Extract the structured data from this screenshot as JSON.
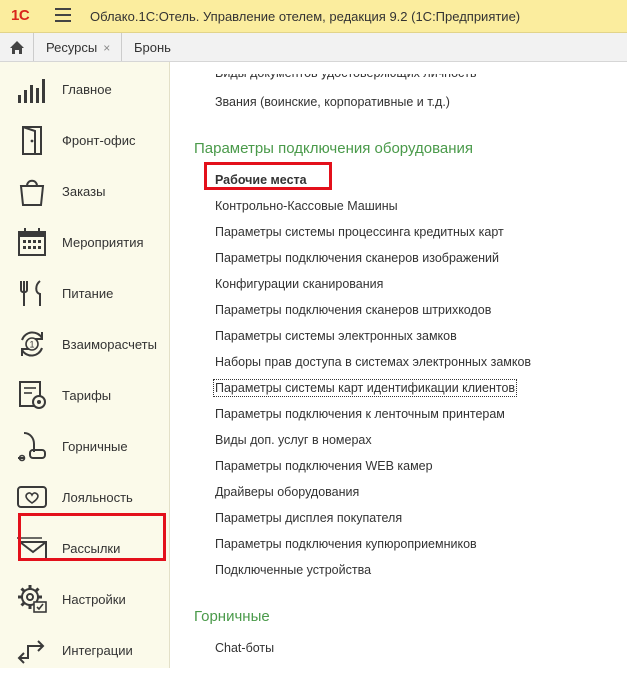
{
  "app": {
    "logo_text": "1С",
    "title": "Облако.1С:Отель. Управление отелем, редакция 9.2  (1С:Предприятие)"
  },
  "tabs": [
    {
      "label": "Ресурсы",
      "close": "×"
    },
    {
      "label": "Бронь",
      "close": ""
    }
  ],
  "sidebar": {
    "items": [
      {
        "label": "Главное",
        "icon": "bar-chart-icon"
      },
      {
        "label": "Фронт-офис",
        "icon": "door-icon"
      },
      {
        "label": "Заказы",
        "icon": "shopping-bag-icon"
      },
      {
        "label": "Мероприятия",
        "icon": "calendar-icon"
      },
      {
        "label": "Питание",
        "icon": "fork-knife-icon"
      },
      {
        "label": "Взаиморасчеты",
        "icon": "circular-arrows-icon"
      },
      {
        "label": "Тарифы",
        "icon": "tariff-tag-icon"
      },
      {
        "label": "Горничные",
        "icon": "vacuum-cleaner-icon"
      },
      {
        "label": "Лояльность",
        "icon": "heart-card-icon"
      },
      {
        "label": "Рассылки",
        "icon": "envelope-icon"
      },
      {
        "label": "Настройки",
        "icon": "gear-settings-icon"
      },
      {
        "label": "Интеграции",
        "icon": "integration-arrows-icon"
      }
    ],
    "selected": "Настройки"
  },
  "content": {
    "cut_line": "Виды документов удостоверяющих личность",
    "top_lines": [
      "Звания (воинские, корпоративные и т.д.)"
    ],
    "section1": {
      "title": "Параметры подключения оборудования",
      "items": [
        "Рабочие места",
        "Контрольно-Кассовые Машины",
        "Параметры системы процессинга кредитных карт",
        "Параметры подключения сканеров изображений",
        "Конфигурации сканирования",
        "Параметры подключения сканеров штрихкодов",
        "Параметры системы электронных замков",
        "Наборы прав доступа в системах электронных замков",
        "Параметры системы карт идентификации клиентов",
        "Параметры подключения к ленточным принтерам",
        "Виды доп. услуг в номерах",
        "Параметры подключения WEB камер",
        "Драйверы оборудования",
        "Параметры дисплея покупателя",
        "Параметры подключения купюроприемников",
        "Подключенные устройства"
      ]
    },
    "section2": {
      "title": "Горничные",
      "items": [
        "Chat-боты"
      ]
    }
  },
  "colors": {
    "title_bar": "#fbed9e",
    "sidebar_bg": "#fbfaea",
    "section_green": "#4a9a4a",
    "highlight_red": "#e3101b",
    "logo_red": "#d9261c"
  }
}
